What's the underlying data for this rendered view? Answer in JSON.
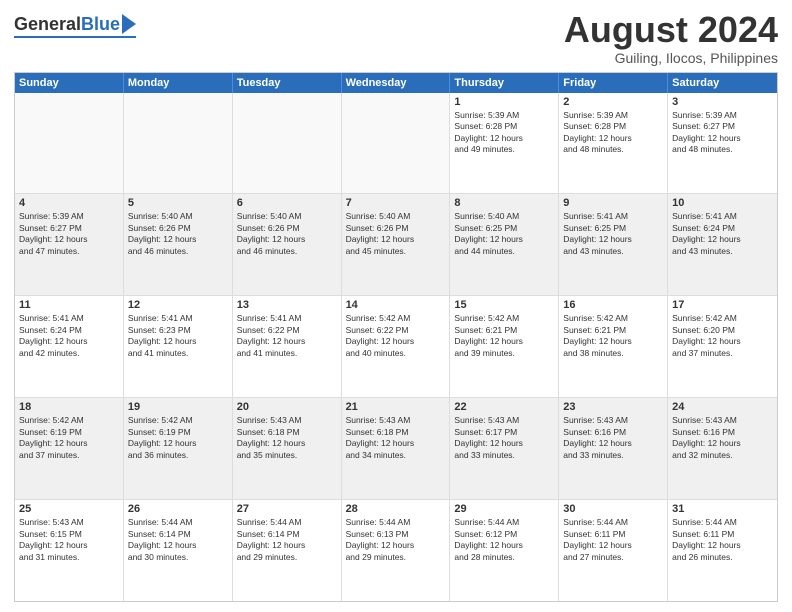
{
  "logo": {
    "general": "General",
    "blue": "Blue"
  },
  "title": "August 2024",
  "subtitle": "Guiling, Ilocos, Philippines",
  "calendar": {
    "headers": [
      "Sunday",
      "Monday",
      "Tuesday",
      "Wednesday",
      "Thursday",
      "Friday",
      "Saturday"
    ],
    "weeks": [
      [
        {
          "day": "",
          "content": "",
          "empty": true
        },
        {
          "day": "",
          "content": "",
          "empty": true
        },
        {
          "day": "",
          "content": "",
          "empty": true
        },
        {
          "day": "",
          "content": "",
          "empty": true
        },
        {
          "day": "1",
          "content": "Sunrise: 5:39 AM\nSunset: 6:28 PM\nDaylight: 12 hours\nand 49 minutes.",
          "empty": false
        },
        {
          "day": "2",
          "content": "Sunrise: 5:39 AM\nSunset: 6:28 PM\nDaylight: 12 hours\nand 48 minutes.",
          "empty": false
        },
        {
          "day": "3",
          "content": "Sunrise: 5:39 AM\nSunset: 6:27 PM\nDaylight: 12 hours\nand 48 minutes.",
          "empty": false
        }
      ],
      [
        {
          "day": "4",
          "content": "Sunrise: 5:39 AM\nSunset: 6:27 PM\nDaylight: 12 hours\nand 47 minutes.",
          "empty": false
        },
        {
          "day": "5",
          "content": "Sunrise: 5:40 AM\nSunset: 6:26 PM\nDaylight: 12 hours\nand 46 minutes.",
          "empty": false
        },
        {
          "day": "6",
          "content": "Sunrise: 5:40 AM\nSunset: 6:26 PM\nDaylight: 12 hours\nand 46 minutes.",
          "empty": false
        },
        {
          "day": "7",
          "content": "Sunrise: 5:40 AM\nSunset: 6:26 PM\nDaylight: 12 hours\nand 45 minutes.",
          "empty": false
        },
        {
          "day": "8",
          "content": "Sunrise: 5:40 AM\nSunset: 6:25 PM\nDaylight: 12 hours\nand 44 minutes.",
          "empty": false
        },
        {
          "day": "9",
          "content": "Sunrise: 5:41 AM\nSunset: 6:25 PM\nDaylight: 12 hours\nand 43 minutes.",
          "empty": false
        },
        {
          "day": "10",
          "content": "Sunrise: 5:41 AM\nSunset: 6:24 PM\nDaylight: 12 hours\nand 43 minutes.",
          "empty": false
        }
      ],
      [
        {
          "day": "11",
          "content": "Sunrise: 5:41 AM\nSunset: 6:24 PM\nDaylight: 12 hours\nand 42 minutes.",
          "empty": false
        },
        {
          "day": "12",
          "content": "Sunrise: 5:41 AM\nSunset: 6:23 PM\nDaylight: 12 hours\nand 41 minutes.",
          "empty": false
        },
        {
          "day": "13",
          "content": "Sunrise: 5:41 AM\nSunset: 6:22 PM\nDaylight: 12 hours\nand 41 minutes.",
          "empty": false
        },
        {
          "day": "14",
          "content": "Sunrise: 5:42 AM\nSunset: 6:22 PM\nDaylight: 12 hours\nand 40 minutes.",
          "empty": false
        },
        {
          "day": "15",
          "content": "Sunrise: 5:42 AM\nSunset: 6:21 PM\nDaylight: 12 hours\nand 39 minutes.",
          "empty": false
        },
        {
          "day": "16",
          "content": "Sunrise: 5:42 AM\nSunset: 6:21 PM\nDaylight: 12 hours\nand 38 minutes.",
          "empty": false
        },
        {
          "day": "17",
          "content": "Sunrise: 5:42 AM\nSunset: 6:20 PM\nDaylight: 12 hours\nand 37 minutes.",
          "empty": false
        }
      ],
      [
        {
          "day": "18",
          "content": "Sunrise: 5:42 AM\nSunset: 6:19 PM\nDaylight: 12 hours\nand 37 minutes.",
          "empty": false
        },
        {
          "day": "19",
          "content": "Sunrise: 5:42 AM\nSunset: 6:19 PM\nDaylight: 12 hours\nand 36 minutes.",
          "empty": false
        },
        {
          "day": "20",
          "content": "Sunrise: 5:43 AM\nSunset: 6:18 PM\nDaylight: 12 hours\nand 35 minutes.",
          "empty": false
        },
        {
          "day": "21",
          "content": "Sunrise: 5:43 AM\nSunset: 6:18 PM\nDaylight: 12 hours\nand 34 minutes.",
          "empty": false
        },
        {
          "day": "22",
          "content": "Sunrise: 5:43 AM\nSunset: 6:17 PM\nDaylight: 12 hours\nand 33 minutes.",
          "empty": false
        },
        {
          "day": "23",
          "content": "Sunrise: 5:43 AM\nSunset: 6:16 PM\nDaylight: 12 hours\nand 33 minutes.",
          "empty": false
        },
        {
          "day": "24",
          "content": "Sunrise: 5:43 AM\nSunset: 6:16 PM\nDaylight: 12 hours\nand 32 minutes.",
          "empty": false
        }
      ],
      [
        {
          "day": "25",
          "content": "Sunrise: 5:43 AM\nSunset: 6:15 PM\nDaylight: 12 hours\nand 31 minutes.",
          "empty": false
        },
        {
          "day": "26",
          "content": "Sunrise: 5:44 AM\nSunset: 6:14 PM\nDaylight: 12 hours\nand 30 minutes.",
          "empty": false
        },
        {
          "day": "27",
          "content": "Sunrise: 5:44 AM\nSunset: 6:14 PM\nDaylight: 12 hours\nand 29 minutes.",
          "empty": false
        },
        {
          "day": "28",
          "content": "Sunrise: 5:44 AM\nSunset: 6:13 PM\nDaylight: 12 hours\nand 29 minutes.",
          "empty": false
        },
        {
          "day": "29",
          "content": "Sunrise: 5:44 AM\nSunset: 6:12 PM\nDaylight: 12 hours\nand 28 minutes.",
          "empty": false
        },
        {
          "day": "30",
          "content": "Sunrise: 5:44 AM\nSunset: 6:11 PM\nDaylight: 12 hours\nand 27 minutes.",
          "empty": false
        },
        {
          "day": "31",
          "content": "Sunrise: 5:44 AM\nSunset: 6:11 PM\nDaylight: 12 hours\nand 26 minutes.",
          "empty": false
        }
      ]
    ]
  }
}
